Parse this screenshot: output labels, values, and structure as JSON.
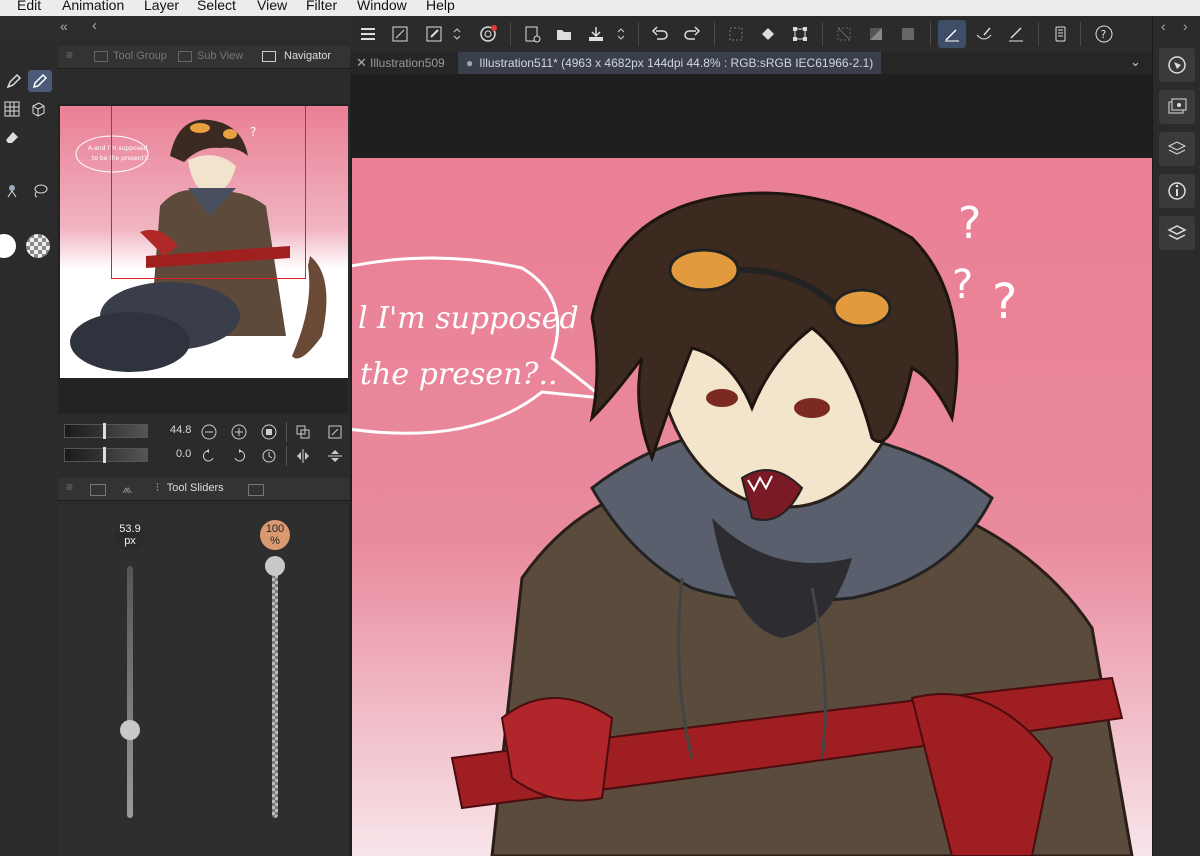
{
  "menu": [
    "Edit",
    "Animation",
    "Layer",
    "Select",
    "View",
    "Filter",
    "Window",
    "Help"
  ],
  "left_panel": {
    "collapse_glyph": "«",
    "back_glyph": "‹",
    "tabs": [
      "Tool Group",
      "Sub View",
      "Navigator"
    ],
    "active_tab": "Navigator",
    "zoom_value": "44.8",
    "rotate_value": "0.0",
    "artwork_thumb_speech": [
      "A-and I'm supposed",
      "to be the present?.."
    ]
  },
  "tool_sliders": {
    "tab_label": "Tool Sliders",
    "size": {
      "value": "53.9",
      "unit": "px",
      "level": 0.35
    },
    "opacity": {
      "value": "100",
      "unit": "%",
      "level": 1.0
    }
  },
  "doc_tabs": [
    {
      "label": "Illustration509",
      "active": false
    },
    {
      "label": "Illustration511* (4963 x 4682px 144dpi 44.8% : RGB:sRGB IEC61966-2.1)",
      "active": true
    }
  ],
  "artwork": {
    "speech_lines": [
      "l I'm supposed",
      "the presen?.."
    ],
    "question_marks": [
      "?",
      "?",
      "?"
    ]
  },
  "colors": {
    "main_color": "#ffffff",
    "active_tool_bg": "#4a5a78",
    "canvas_pink": "#ea7f95",
    "opacity_badge": "#d99a72"
  }
}
